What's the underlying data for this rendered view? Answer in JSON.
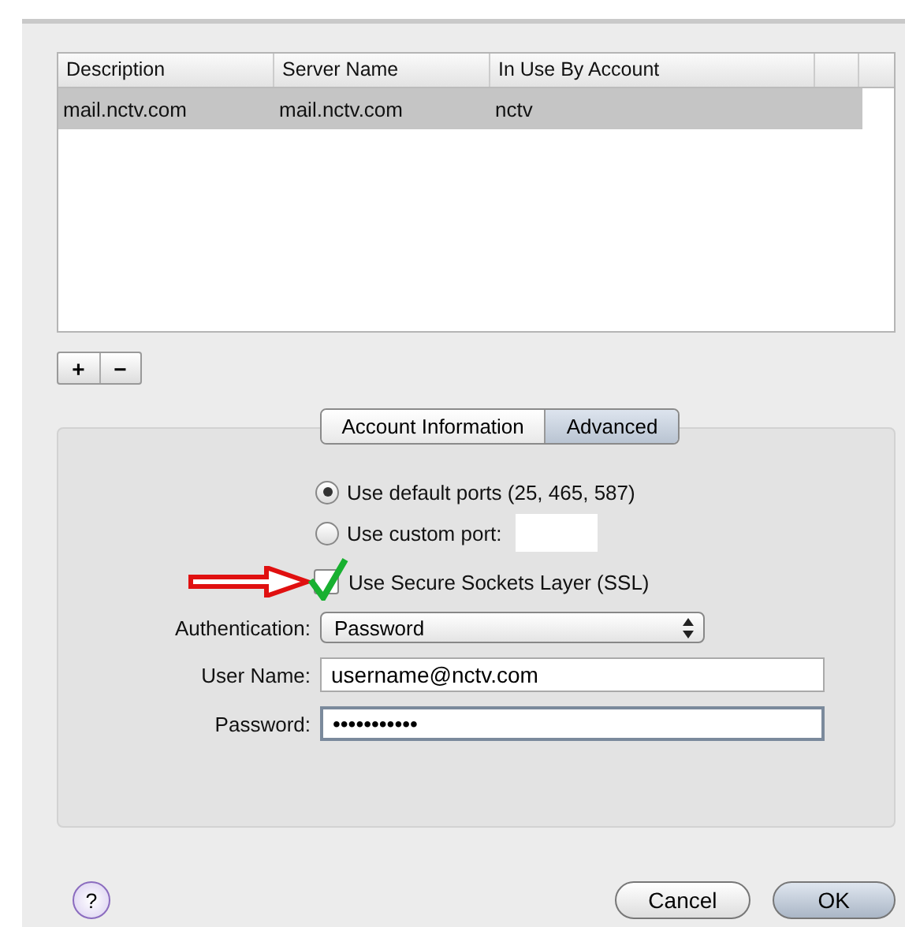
{
  "server_table": {
    "columns": [
      "Description",
      "Server Name",
      "In Use By Account"
    ],
    "rows": [
      {
        "cells": [
          "mail.nctv.com",
          "mail.nctv.com",
          "nctv"
        ],
        "selected": true
      }
    ]
  },
  "list_buttons": [
    "+",
    "−"
  ],
  "tabs": [
    {
      "label": "Account Information",
      "selected": false
    },
    {
      "label": "Advanced",
      "selected": true
    }
  ],
  "port_options": [
    {
      "label": "Use default ports (25, 465, 587)",
      "selected": true,
      "kind": "plain"
    },
    {
      "label": "Use custom port:",
      "selected": false,
      "kind": "field"
    }
  ],
  "ssl": {
    "label": "Use Secure Sockets Layer (SSL)",
    "checked": true
  },
  "authentication": {
    "label": "Authentication:",
    "value": "Password"
  },
  "user_name": {
    "label": "User Name:",
    "value": "username@nctv.com"
  },
  "password": {
    "label": "Password:",
    "value": "•••••••••••"
  },
  "help": "?",
  "buttons": [
    {
      "label": "Cancel",
      "kind": "normal"
    },
    {
      "label": "OK",
      "kind": "default"
    }
  ]
}
